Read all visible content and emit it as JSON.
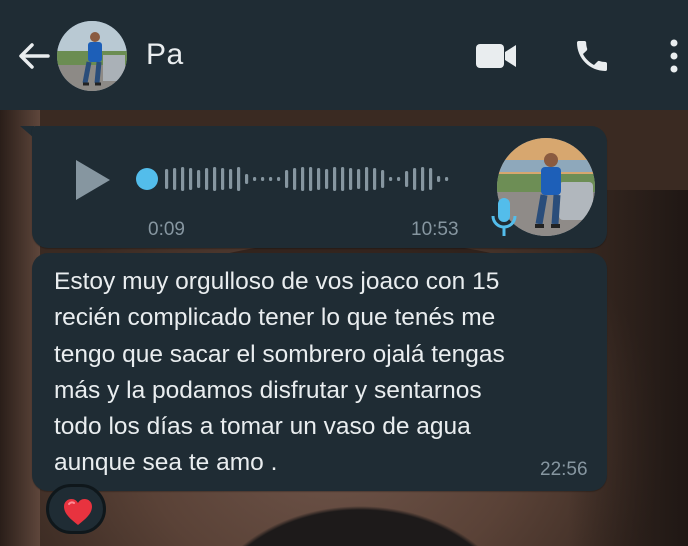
{
  "header": {
    "contact_name": "Pa",
    "icons": [
      "back-arrow-icon",
      "video-call-icon",
      "phone-call-icon",
      "more-options-icon"
    ]
  },
  "voice_message": {
    "duration": "0:09",
    "time": "10:53",
    "icons": [
      "play-icon",
      "microphone-icon"
    ],
    "progress": 0
  },
  "text_message": {
    "text": "Estoy muy orgulloso de vos joaco con 15\nrecién complicado tener lo que tenés me\ntengo que sacar el sombrero ojalá tengas\nmás y la podamos disfrutar y sentarnos\ntodo los días a tomar un vaso de agua\naunque sea te amo .",
    "time": "22:56",
    "reaction": "❤️"
  },
  "colors": {
    "header_bg": "#1f2c34",
    "bubble_bg": "#1f2c34",
    "accent_blue": "#53bdeb",
    "meta_text": "#8696a0",
    "primary_text": "#e9edef"
  }
}
